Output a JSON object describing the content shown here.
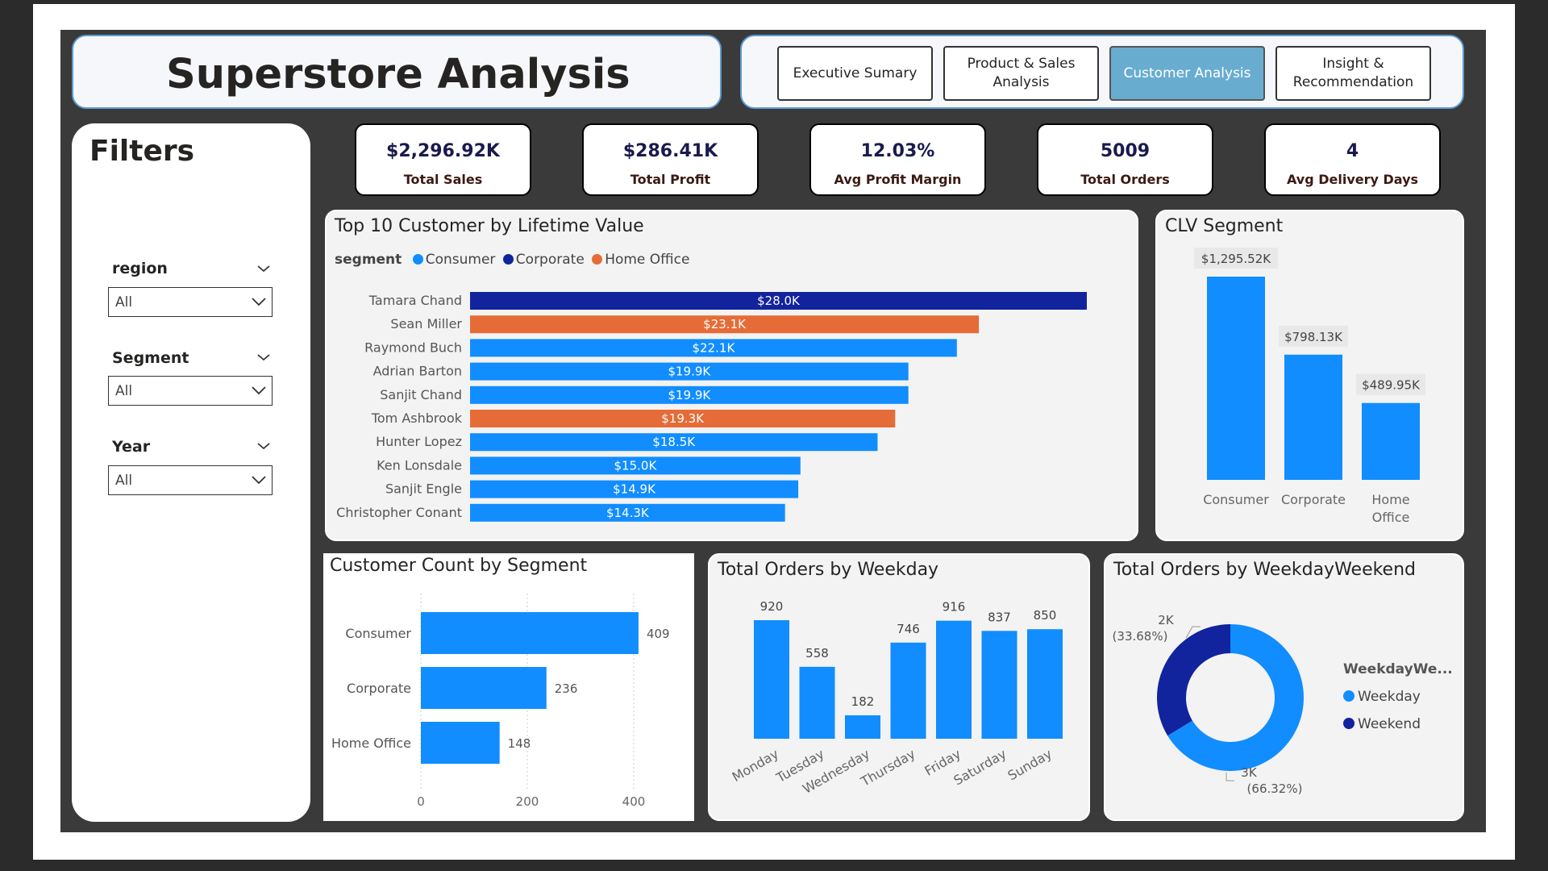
{
  "title": "Superstore Analysis",
  "nav": [
    {
      "label": "Executive Sumary",
      "active": false
    },
    {
      "label": "Product & Sales Analysis",
      "active": false
    },
    {
      "label": "Customer Analysis",
      "active": true
    },
    {
      "label": "Insight & Recommendation",
      "active": false
    }
  ],
  "filters": {
    "title": "Filters",
    "items": [
      {
        "label": "region",
        "value": "All"
      },
      {
        "label": "Segment",
        "value": "All"
      },
      {
        "label": "Year",
        "value": "All"
      }
    ]
  },
  "kpis": [
    {
      "value": "$2,296.92K",
      "label": "Total Sales"
    },
    {
      "value": "$286.41K",
      "label": "Total Profit"
    },
    {
      "value": "12.03%",
      "label": "Avg Profit Margin"
    },
    {
      "value": "5009",
      "label": "Total Orders"
    },
    {
      "value": "4",
      "label": "Avg Delivery Days"
    }
  ],
  "colors": {
    "consumer": "#118dff",
    "corporate": "#12239e",
    "home_office": "#e66c37",
    "weekday": "#118dff",
    "weekend": "#12239e"
  },
  "chart_data": [
    {
      "type": "bar",
      "orientation": "horizontal",
      "title": "Top 10 Customer by Lifetime Value",
      "legend_title": "segment",
      "legend": [
        "Consumer",
        "Corporate",
        "Home Office"
      ],
      "categories": [
        "Tamara Chand",
        "Sean Miller",
        "Raymond Buch",
        "Adrian Barton",
        "Sanjit Chand",
        "Tom Ashbrook",
        "Hunter Lopez",
        "Ken Lonsdale",
        "Sanjit Engle",
        "Christopher Conant"
      ],
      "values": [
        28.0,
        23.1,
        22.1,
        19.9,
        19.9,
        19.3,
        18.5,
        15.0,
        14.9,
        14.3
      ],
      "labels": [
        "$28.0K",
        "$23.1K",
        "$22.1K",
        "$19.9K",
        "$19.9K",
        "$19.3K",
        "$18.5K",
        "$15.0K",
        "$14.9K",
        "$14.3K"
      ],
      "segments": [
        "Corporate",
        "Home Office",
        "Consumer",
        "Consumer",
        "Consumer",
        "Home Office",
        "Consumer",
        "Consumer",
        "Consumer",
        "Consumer"
      ]
    },
    {
      "type": "bar",
      "title": "CLV Segment",
      "categories": [
        "Consumer",
        "Corporate",
        "Home Office"
      ],
      "values": [
        1295.52,
        798.13,
        489.95
      ],
      "labels": [
        "$1,295.52K",
        "$798.13K",
        "$489.95K"
      ]
    },
    {
      "type": "bar",
      "orientation": "horizontal",
      "title": "Customer Count by Segment",
      "categories": [
        "Consumer",
        "Corporate",
        "Home Office"
      ],
      "values": [
        409,
        236,
        148
      ],
      "xticks": [
        0,
        200,
        400
      ],
      "xlim": [
        0,
        400
      ]
    },
    {
      "type": "bar",
      "title": "Total Orders by Weekday",
      "categories": [
        "Monday",
        "Tuesday",
        "Wednesday",
        "Thursday",
        "Friday",
        "Saturday",
        "Sunday"
      ],
      "values": [
        920,
        558,
        182,
        746,
        916,
        837,
        850
      ]
    },
    {
      "type": "pie",
      "title": "Total Orders by WeekdayWeekend",
      "legend_title": "WeekdayWe...",
      "categories": [
        "Weekday",
        "Weekend"
      ],
      "values": [
        3322,
        1687
      ],
      "labels": [
        "3K",
        "2K"
      ],
      "percents": [
        "(66.32%)",
        "(33.68%)"
      ]
    }
  ]
}
